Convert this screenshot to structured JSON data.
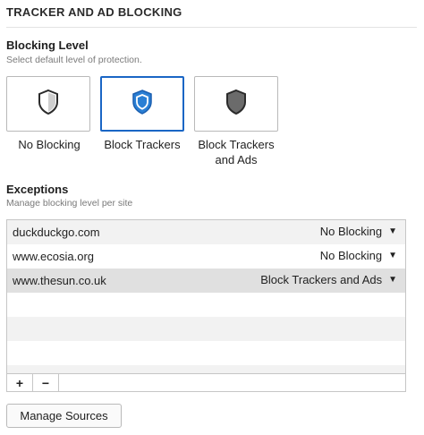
{
  "section": {
    "title": "TRACKER AND AD BLOCKING"
  },
  "blocking_level": {
    "title": "Blocking Level",
    "subtitle": "Select default level of protection.",
    "options": [
      {
        "label": "No Blocking",
        "icon": "shield-outline-icon",
        "selected": false
      },
      {
        "label": "Block Trackers",
        "icon": "shield-blue-icon",
        "selected": true
      },
      {
        "label": "Block Trackers\nand Ads",
        "icon": "shield-dark-icon",
        "selected": false
      }
    ]
  },
  "exceptions": {
    "title": "Exceptions",
    "subtitle": "Manage blocking level per site",
    "rows": [
      {
        "site": "duckduckgo.com",
        "level": "No Blocking"
      },
      {
        "site": "www.ecosia.org",
        "level": "No Blocking"
      },
      {
        "site": "www.thesun.co.uk",
        "level": "Block Trackers and Ads"
      }
    ],
    "add_label": "+",
    "remove_label": "−"
  },
  "manage_sources": {
    "label": "Manage Sources"
  },
  "colors": {
    "accent": "#1a66c5",
    "shield_blue": "#2a7fd4",
    "shield_dark": "#6b6b6b"
  }
}
